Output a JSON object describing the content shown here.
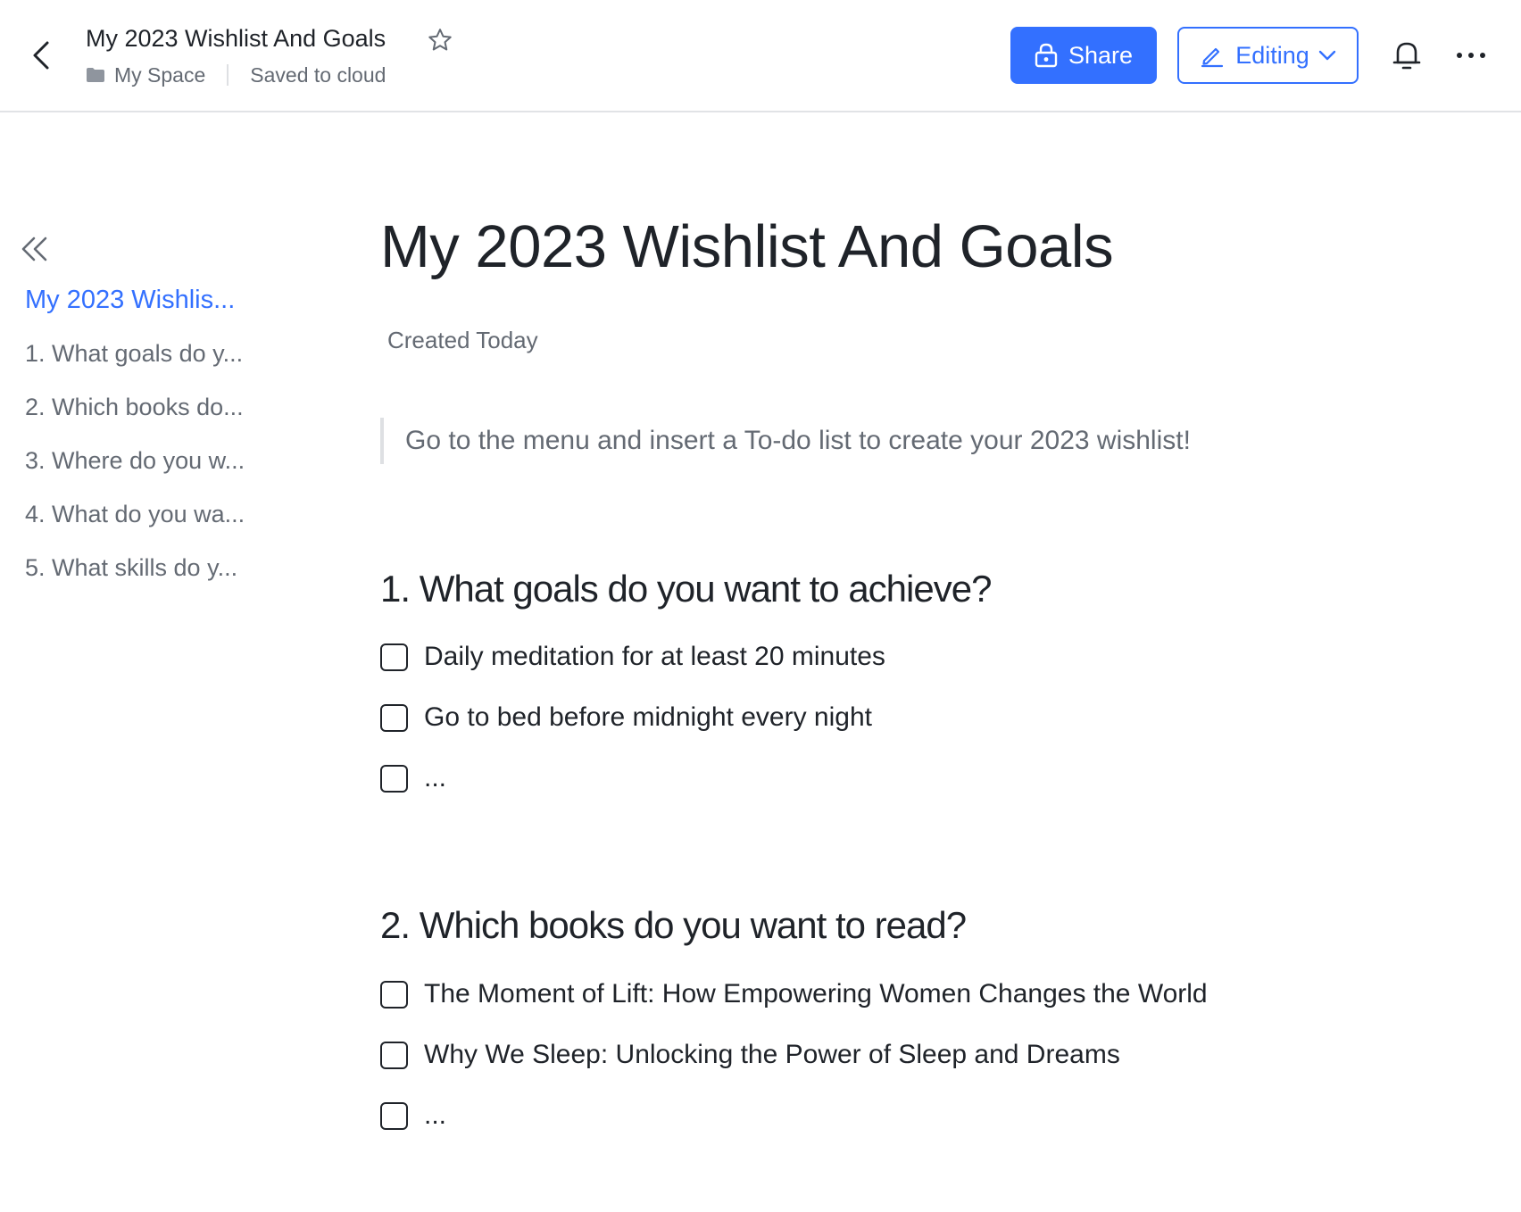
{
  "header": {
    "title": "My 2023 Wishlist And Goals",
    "location": "My Space",
    "save_status": "Saved to cloud",
    "share_label": "Share",
    "editing_label": "Editing"
  },
  "outline": {
    "items": [
      {
        "label": "My 2023 Wishlis..."
      },
      {
        "label": "1. What goals do y..."
      },
      {
        "label": "2. Which books do..."
      },
      {
        "label": "3. Where do you w..."
      },
      {
        "label": "4. What do you wa..."
      },
      {
        "label": "5. What skills do y..."
      }
    ]
  },
  "document": {
    "title": "My 2023 Wishlist And Goals",
    "created": "Created Today",
    "callout": "Go to the menu and insert a To-do list to create your 2023 wishlist!",
    "sections": [
      {
        "heading": "1. What goals do you want to achieve?",
        "todos": [
          {
            "text": "Daily meditation for at least 20 minutes",
            "checked": false
          },
          {
            "text": "Go to bed before midnight every night",
            "checked": false
          },
          {
            "text": "...",
            "checked": false
          }
        ]
      },
      {
        "heading": "2. Which books do you want to read?",
        "todos": [
          {
            "text": "The Moment of Lift: How Empowering Women Changes the World",
            "checked": false
          },
          {
            "text": "Why We Sleep: Unlocking the Power of Sleep and Dreams",
            "checked": false
          },
          {
            "text": "...",
            "checked": false
          }
        ]
      }
    ]
  },
  "colors": {
    "accent": "#3370ff",
    "text": "#1f2329",
    "muted": "#646a73",
    "divider": "#dee0e3"
  }
}
